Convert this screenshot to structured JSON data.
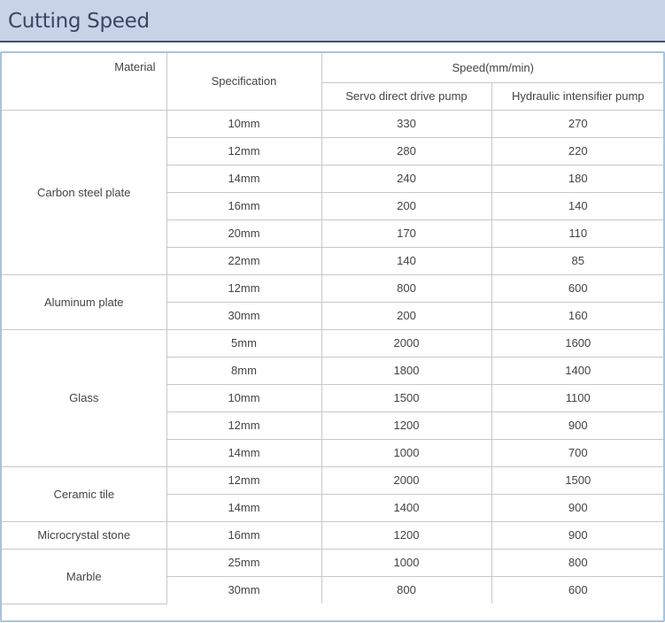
{
  "page": {
    "title": "Cutting Speed"
  },
  "table": {
    "headers": {
      "material": "Material",
      "specification": "Specification",
      "speed_group": "Speed(mm/min)",
      "servo": "Servo direct drive pump",
      "hydraulic": "Hydraulic intensifier pump"
    },
    "groups": [
      {
        "material": "Carbon steel plate",
        "rows": [
          {
            "spec": "10mm",
            "servo": "330",
            "hydraulic": "270"
          },
          {
            "spec": "12mm",
            "servo": "280",
            "hydraulic": "220"
          },
          {
            "spec": "14mm",
            "servo": "240",
            "hydraulic": "180"
          },
          {
            "spec": "16mm",
            "servo": "200",
            "hydraulic": "140"
          },
          {
            "spec": "20mm",
            "servo": "170",
            "hydraulic": "110"
          },
          {
            "spec": "22mm",
            "servo": "140",
            "hydraulic": "85"
          }
        ]
      },
      {
        "material": "Aluminum plate",
        "rows": [
          {
            "spec": "12mm",
            "servo": "800",
            "hydraulic": "600"
          },
          {
            "spec": "30mm",
            "servo": "200",
            "hydraulic": "160"
          }
        ]
      },
      {
        "material": "Glass",
        "rows": [
          {
            "spec": "5mm",
            "servo": "2000",
            "hydraulic": "1600"
          },
          {
            "spec": "8mm",
            "servo": "1800",
            "hydraulic": "1400"
          },
          {
            "spec": "10mm",
            "servo": "1500",
            "hydraulic": "1100"
          },
          {
            "spec": "12mm",
            "servo": "1200",
            "hydraulic": "900"
          },
          {
            "spec": "14mm",
            "servo": "1000",
            "hydraulic": "700"
          }
        ]
      },
      {
        "material": "Ceramic tile",
        "rows": [
          {
            "spec": "12mm",
            "servo": "2000",
            "hydraulic": "1500"
          },
          {
            "spec": "14mm",
            "servo": "1400",
            "hydraulic": "900"
          }
        ]
      },
      {
        "material": "Microcrystal stone",
        "rows": [
          {
            "spec": "16mm",
            "servo": "1200",
            "hydraulic": "900"
          }
        ]
      },
      {
        "material": "Marble",
        "rows": [
          {
            "spec": "25mm",
            "servo": "1000",
            "hydraulic": "800"
          },
          {
            "spec": "30mm",
            "servo": "800",
            "hydraulic": "600"
          }
        ]
      }
    ]
  }
}
